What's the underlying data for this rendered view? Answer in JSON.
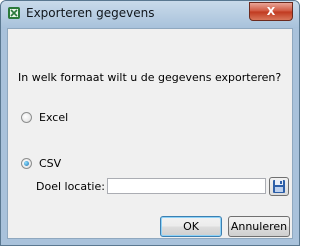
{
  "window": {
    "title": "Exporteren gegevens",
    "close_glyph": "X"
  },
  "prompt": "In welk formaat wilt u de gegevens exporteren?",
  "options": [
    {
      "label": "Excel",
      "selected": false
    },
    {
      "label": "CSV",
      "selected": true
    }
  ],
  "target": {
    "label": "Doel locatie:",
    "value": "",
    "browse_icon": "floppy-disk-icon"
  },
  "buttons": {
    "ok": "OK",
    "cancel": "Annuleren"
  },
  "colors": {
    "accent": "#1b6fb0",
    "title_bar": "#a9c2db",
    "close": "#c0391f"
  }
}
